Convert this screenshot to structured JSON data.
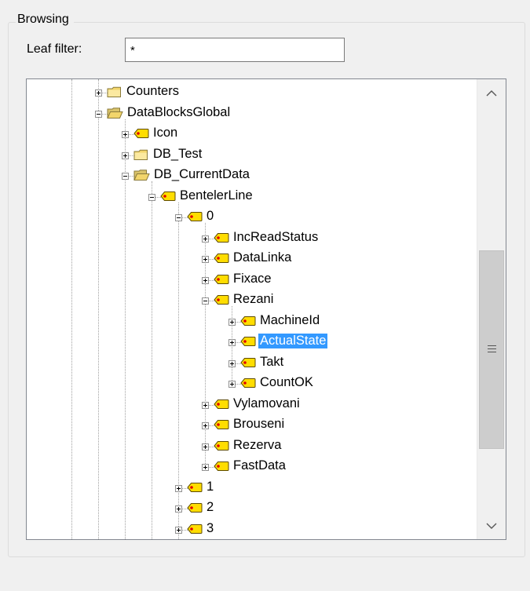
{
  "group": {
    "title": "Browsing"
  },
  "filter": {
    "label": "Leaf filter:",
    "value": "*"
  },
  "tree": {
    "nodes": [
      {
        "label": "Counters",
        "level": 0,
        "type": "folder",
        "expanded": false,
        "selected": false
      },
      {
        "label": "DataBlocksGlobal",
        "level": 0,
        "type": "folder-open",
        "expanded": true,
        "selected": false
      },
      {
        "label": "Icon",
        "level": 1,
        "type": "tag",
        "expanded": false,
        "selected": false
      },
      {
        "label": "DB_Test",
        "level": 1,
        "type": "folder",
        "expanded": false,
        "selected": false
      },
      {
        "label": "DB_CurrentData",
        "level": 1,
        "type": "folder-open",
        "expanded": true,
        "selected": false
      },
      {
        "label": "BentelerLine",
        "level": 2,
        "type": "tag",
        "expanded": true,
        "selected": false
      },
      {
        "label": "0",
        "level": 3,
        "type": "tag",
        "expanded": true,
        "selected": false
      },
      {
        "label": "IncReadStatus",
        "level": 4,
        "type": "tag",
        "expanded": false,
        "selected": false
      },
      {
        "label": "DataLinka",
        "level": 4,
        "type": "tag",
        "expanded": false,
        "selected": false
      },
      {
        "label": "Fixace",
        "level": 4,
        "type": "tag",
        "expanded": false,
        "selected": false
      },
      {
        "label": "Rezani",
        "level": 4,
        "type": "tag",
        "expanded": true,
        "selected": false
      },
      {
        "label": "MachineId",
        "level": 5,
        "type": "tag",
        "expanded": false,
        "selected": false
      },
      {
        "label": "ActualState",
        "level": 5,
        "type": "tag",
        "expanded": false,
        "selected": true
      },
      {
        "label": "Takt",
        "level": 5,
        "type": "tag",
        "expanded": false,
        "selected": false
      },
      {
        "label": "CountOK",
        "level": 5,
        "type": "tag",
        "expanded": false,
        "selected": false
      },
      {
        "label": "Vylamovani",
        "level": 4,
        "type": "tag",
        "expanded": false,
        "selected": false
      },
      {
        "label": "Brouseni",
        "level": 4,
        "type": "tag",
        "expanded": false,
        "selected": false
      },
      {
        "label": "Rezerva",
        "level": 4,
        "type": "tag",
        "expanded": false,
        "selected": false
      },
      {
        "label": "FastData",
        "level": 4,
        "type": "tag",
        "expanded": false,
        "selected": false
      },
      {
        "label": "1",
        "level": 3,
        "type": "tag",
        "expanded": false,
        "selected": false
      },
      {
        "label": "2",
        "level": 3,
        "type": "tag",
        "expanded": false,
        "selected": false
      },
      {
        "label": "3",
        "level": 3,
        "type": "tag",
        "expanded": false,
        "selected": false
      }
    ]
  },
  "scrollbar": {
    "up_icon": "chevron-up-icon",
    "down_icon": "chevron-down-icon",
    "thumb_icon": "grip-icon"
  },
  "colors": {
    "selection": "#3399ff",
    "folder": "#f2d56b",
    "tag": "#ffdd00",
    "tag_dot": "#e00000"
  }
}
